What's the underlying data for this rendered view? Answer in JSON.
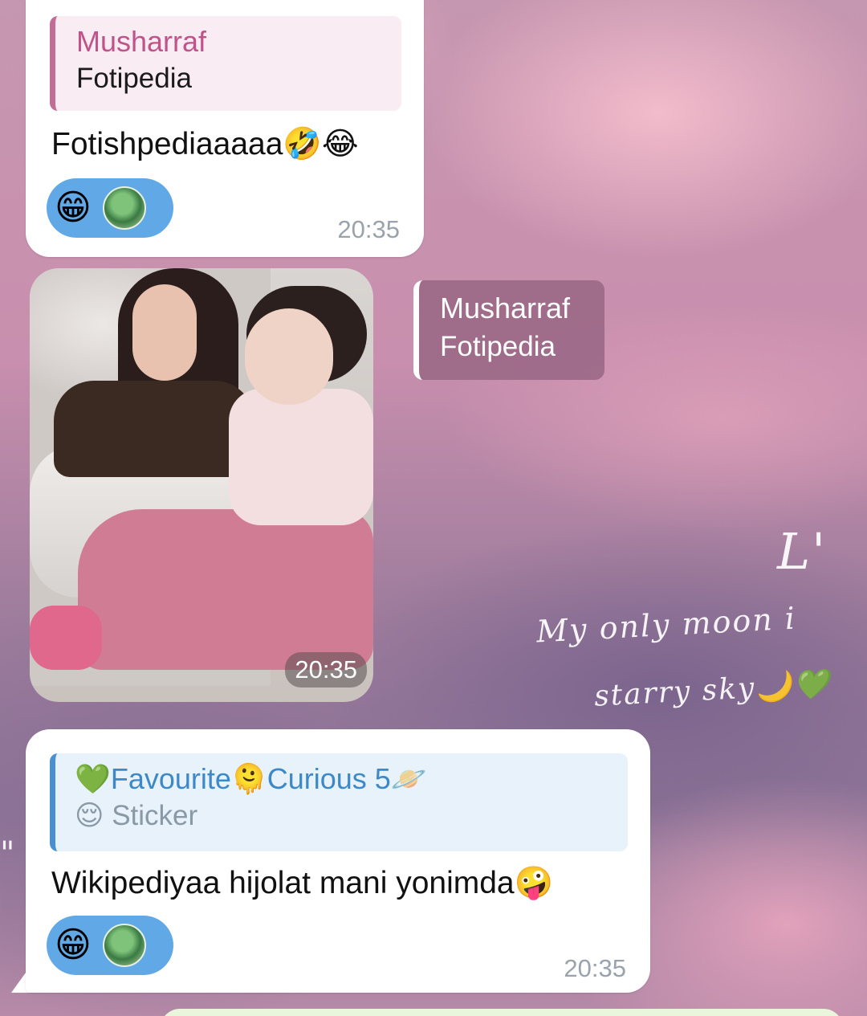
{
  "messages": [
    {
      "reply_to": {
        "name": "Musharraf",
        "text": "Fotipedia"
      },
      "text": "Fotishpediaaaaa🤣😂",
      "reactions": {
        "emoji": "😁"
      },
      "time": "20:35"
    },
    {
      "type": "photo",
      "time": "20:35",
      "reply_to": {
        "name": "Musharraf",
        "text": "Fotipedia"
      }
    },
    {
      "reply_to": {
        "name": "💚Favourite🫠Curious 5🪐",
        "text": "😌 Sticker"
      },
      "text": "Wikipediyaa hijolat mani yonimda🤪",
      "reactions": {
        "emoji": "😁"
      },
      "time": "20:35"
    }
  ],
  "wallpaper": {
    "script_lines": [
      "L'",
      "My only moon i",
      "starry sky🌙💚",
      "\""
    ]
  },
  "colors": {
    "reaction_bg": "#61a8e6",
    "reply_pink": "#c0548a",
    "reply_blue": "#3d89c8",
    "bubble": "#ffffff"
  }
}
